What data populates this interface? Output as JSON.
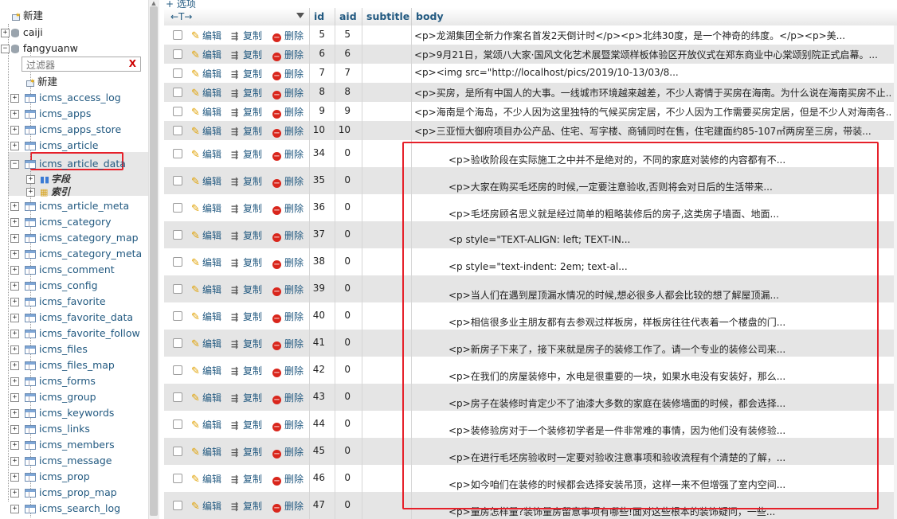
{
  "nav": {
    "top_new": "新建",
    "databases": [
      "caiji",
      "fangyuanw"
    ],
    "filter_placeholder": "过滤器",
    "filter_clear": "X",
    "db_new": "新建",
    "tables_before": [
      "icms_access_log",
      "icms_apps",
      "icms_apps_store",
      "icms_article"
    ],
    "selected_table": "icms_article_data",
    "selected_children": [
      "字段",
      "索引"
    ],
    "tables_after": [
      "icms_article_meta",
      "icms_category",
      "icms_category_map",
      "icms_category_meta",
      "icms_comment",
      "icms_config",
      "icms_favorite",
      "icms_favorite_data",
      "icms_favorite_follow",
      "icms_files",
      "icms_files_map",
      "icms_forms",
      "icms_group",
      "icms_keywords",
      "icms_links",
      "icms_members",
      "icms_message",
      "icms_prop",
      "icms_prop_map",
      "icms_search_log"
    ]
  },
  "grid": {
    "options_link": "+ 选项",
    "col_arrows": "←T→",
    "columns": [
      "id",
      "aid",
      "subtitle",
      "body"
    ],
    "actions": {
      "edit": "编辑",
      "copy": "复制",
      "delete": "删除"
    },
    "rows": [
      {
        "id": "5",
        "aid": "5",
        "body": "<p>龙湖集团全新力作案名首发2天倒计时</p><p>北纬30度，是一个神奇的纬度。</p><p>美..."
      },
      {
        "id": "6",
        "aid": "6",
        "body": "<p>9月21日，棠颂八大家·国风文化艺术展暨棠颂样板体验区开放仪式在郑东商业中心棠颂别院正式启幕。..."
      },
      {
        "id": "7",
        "aid": "7",
        "body": "<p><img src=\"http://localhost/pics/2019/10-13/03/8..."
      },
      {
        "id": "8",
        "aid": "8",
        "body": "<p>买房，是所有中国人的大事。一线城市环境越来越差，不少人寄情于买房在海南。为什么说在海南买房不止..."
      },
      {
        "id": "9",
        "aid": "9",
        "body": "<p>海南是个海岛，不少人因为这里独特的气候买房定居，不少人因为工作需要买房定居，但是不少人对海南各..."
      },
      {
        "id": "10",
        "aid": "10",
        "body": "<p>三亚恒大御府项目办公产品、住宅、写字楼、商铺同时在售，住宅建面约85-107㎡两房至三房，带装..."
      },
      {
        "id": "34",
        "aid": "0",
        "body": "<p>验收阶段在实际施工之中并不是绝对的，不同的家庭对装修的内容都有不..."
      },
      {
        "id": "35",
        "aid": "0",
        "body": "<p>大家在购买毛坯房的时候,一定要注意验收,否则将会对日后的生活带来..."
      },
      {
        "id": "36",
        "aid": "0",
        "body": "<p>毛坯房顾名思义就是经过简单的粗略装修后的房子,这类房子墙面、地面..."
      },
      {
        "id": "37",
        "aid": "0",
        "body": "<p style=\"TEXT-ALIGN: left; TEXT-IN..."
      },
      {
        "id": "38",
        "aid": "0",
        "body": "<p style=\"text-indent: 2em; text-al..."
      },
      {
        "id": "39",
        "aid": "0",
        "body": "<p>当人们在遇到屋顶漏水情况的时候,想必很多人都会比较的想了解屋顶漏..."
      },
      {
        "id": "40",
        "aid": "0",
        "body": "<p>相信很多业主朋友都有去参观过样板房，样板房往往代表着一个楼盘的门..."
      },
      {
        "id": "41",
        "aid": "0",
        "body": "<p>新房子下来了，接下来就是房子的装修工作了。请一个专业的装修公司来..."
      },
      {
        "id": "42",
        "aid": "0",
        "body": "<p>在我们的房屋装修中，水电是很重要的一块，如果水电没有安装好，那么..."
      },
      {
        "id": "43",
        "aid": "0",
        "body": "<p>房子在装修时肯定少不了油漆大多数的家庭在装修墙面的时候，都会选择..."
      },
      {
        "id": "44",
        "aid": "0",
        "body": "<p>装修验房对于一个装修初学者是一件非常难的事情，因为他们没有装修验..."
      },
      {
        "id": "45",
        "aid": "0",
        "body": "<p>在进行毛坯房验收时一定要对验收注意事项和验收流程有个清楚的了解，..."
      },
      {
        "id": "46",
        "aid": "0",
        "body": "<p>如今咱们在装修的时候都会选择安装吊顶，这样一来不但增强了室内空间..."
      },
      {
        "id": "47",
        "aid": "0",
        "body": "<p>量房怎样量?装饰量房留意事项有哪些!面对这些根本的装饰疑问，一些..."
      }
    ]
  },
  "colors": {
    "link": "#235a81",
    "highlight_box": "#e6202a",
    "row_alt": "#e5e5e5",
    "delete_icon": "#d9261c"
  }
}
